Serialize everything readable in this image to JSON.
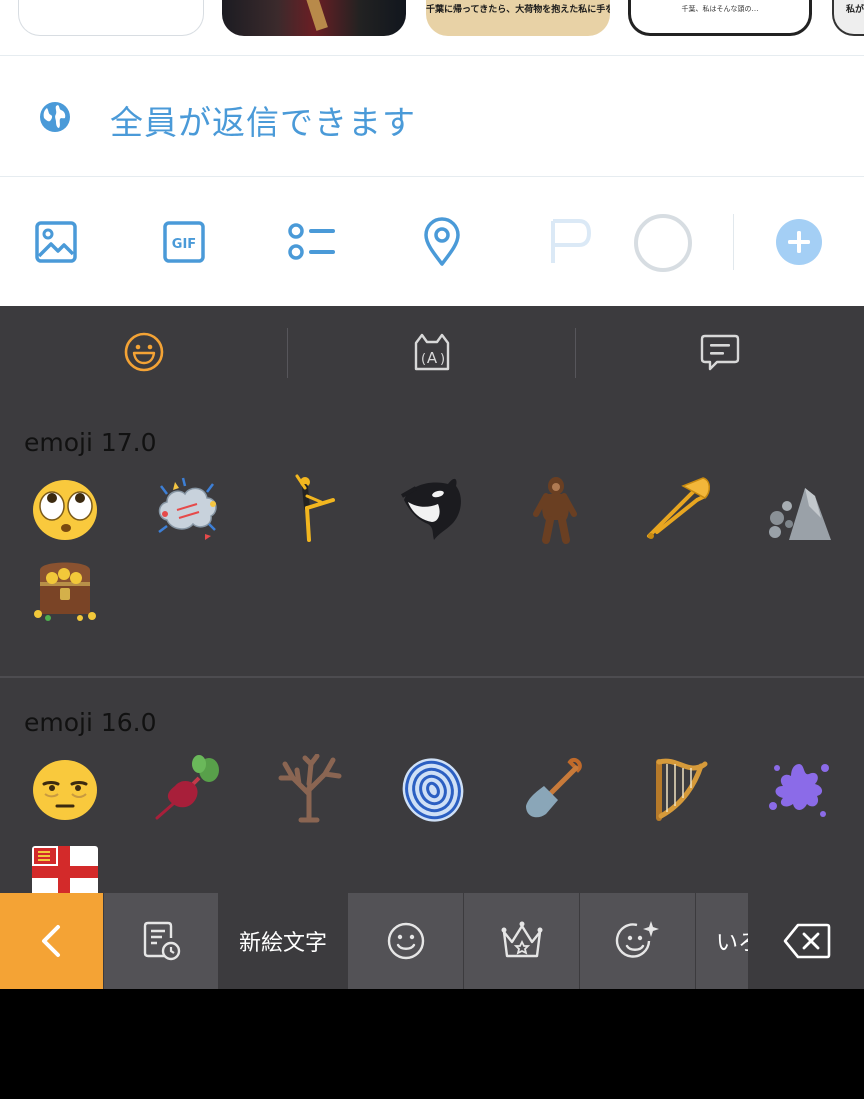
{
  "thumbnails": {
    "card2_caption": "千葉に帰ってきたら、大荷物を抱えた私に手を振る小さな集団が！",
    "card3_caption": "千葉、私はそんな頭の…",
    "card4_caption": "私が"
  },
  "reply_setting": {
    "icon": "globe-icon",
    "label": "全員が返信できます"
  },
  "toolbar": {
    "icons": [
      "image-icon",
      "gif-icon",
      "poll-icon",
      "location-icon",
      "schedule-icon",
      "character-count-ring",
      "add-thread-icon"
    ],
    "accent": "#4a9ad8"
  },
  "keyboard": {
    "tabs": [
      "emoji-tab-icon",
      "kaomoji-tab-icon",
      "sticker-message-tab-icon"
    ],
    "active_accent": "#f4a335",
    "sections": [
      {
        "title": "emoji 17.0",
        "emoji": [
          "🫪",
          "🫯",
          "🧑‍🩰",
          "🫍",
          "🫈",
          "🪊",
          "🛘",
          "🫝"
        ],
        "icons": [
          "distorted-face",
          "fight-cloud",
          "ballet-dancer",
          "orca",
          "hairy-creature",
          "trombone",
          "landslide",
          "treasure-chest"
        ]
      },
      {
        "title": "emoji 16.0",
        "emoji": [
          "🫩",
          "🫜",
          "🪾",
          "🫆",
          "🪏",
          "🪉",
          "🫟",
          "🏴"
        ],
        "icons": [
          "face-with-bags-under-eyes",
          "root-vegetable",
          "leafless-tree",
          "fingerprint",
          "shovel",
          "harp",
          "splatter",
          "flag-sark"
        ]
      }
    ]
  },
  "kb_bar": {
    "back_icon": "chevron-left-icon",
    "history_icon": "recent-history-icon",
    "new_emoji_label": "新絵文字",
    "smiley_icon": "smiley-icon",
    "crown_icon": "crown-icon",
    "sparkle_icon": "sparkle-face-icon",
    "more_label": "いろ",
    "delete_icon": "backspace-icon"
  }
}
